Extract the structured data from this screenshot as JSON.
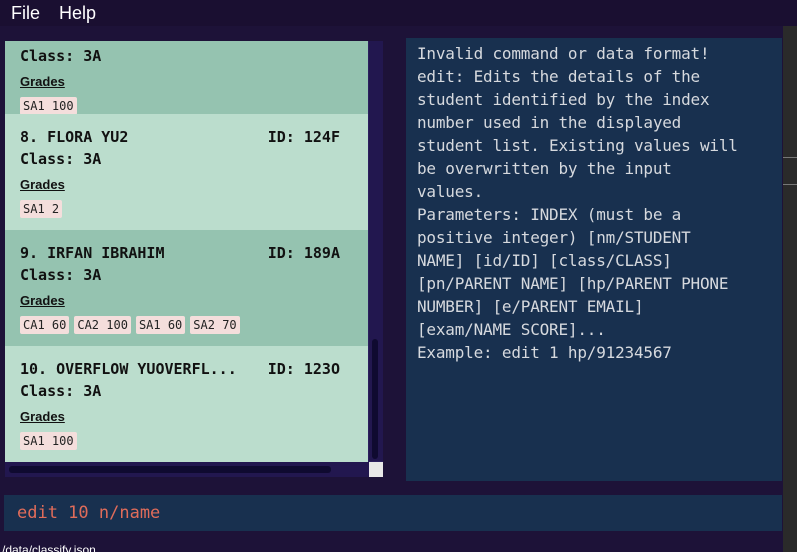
{
  "menu": {
    "file": "File",
    "help": "Help"
  },
  "students": [
    {
      "title": "",
      "id": "",
      "class": "Class: 3A",
      "grades_label": "Grades",
      "grades": [
        "SA1 100"
      ]
    },
    {
      "title": "8.  FLORA YU2",
      "id": "ID: 124F",
      "class": "Class: 3A",
      "grades_label": "Grades",
      "grades": [
        "SA1 2"
      ]
    },
    {
      "title": "9.  IRFAN IBRAHIM",
      "id": "ID: 189A",
      "class": "Class: 3A",
      "grades_label": "Grades",
      "grades": [
        "CA1 60",
        "CA2 100",
        "SA1 60",
        "SA2 70"
      ]
    },
    {
      "title": "10.  OVERFLOW YUOVERFL...",
      "id": "ID: 123O",
      "class": "Class: 3A",
      "grades_label": "Grades",
      "grades": [
        "SA1 100"
      ]
    }
  ],
  "result": {
    "text": "Invalid command or data format!\nedit: Edits the details of the\nstudent identified by the index\nnumber used in the displayed\nstudent list. Existing values will\nbe overwritten by the input\nvalues.\nParameters: INDEX (must be a\npositive integer) [nm/STUDENT\nNAME] [id/ID] [class/CLASS]\n[pn/PARENT NAME] [hp/PARENT PHONE\nNUMBER] [e/PARENT EMAIL]\n[exam/NAME SCORE]...\nExample: edit 1 hp/91234567"
  },
  "command": {
    "value": "edit 10 n/name"
  },
  "status": {
    "path": "/data/classify.json"
  },
  "colors": {
    "card_dark": "#95c3b0",
    "card_light": "#bbddcd",
    "command_text": "#e06c5a",
    "panel_bg": "#18304f"
  }
}
